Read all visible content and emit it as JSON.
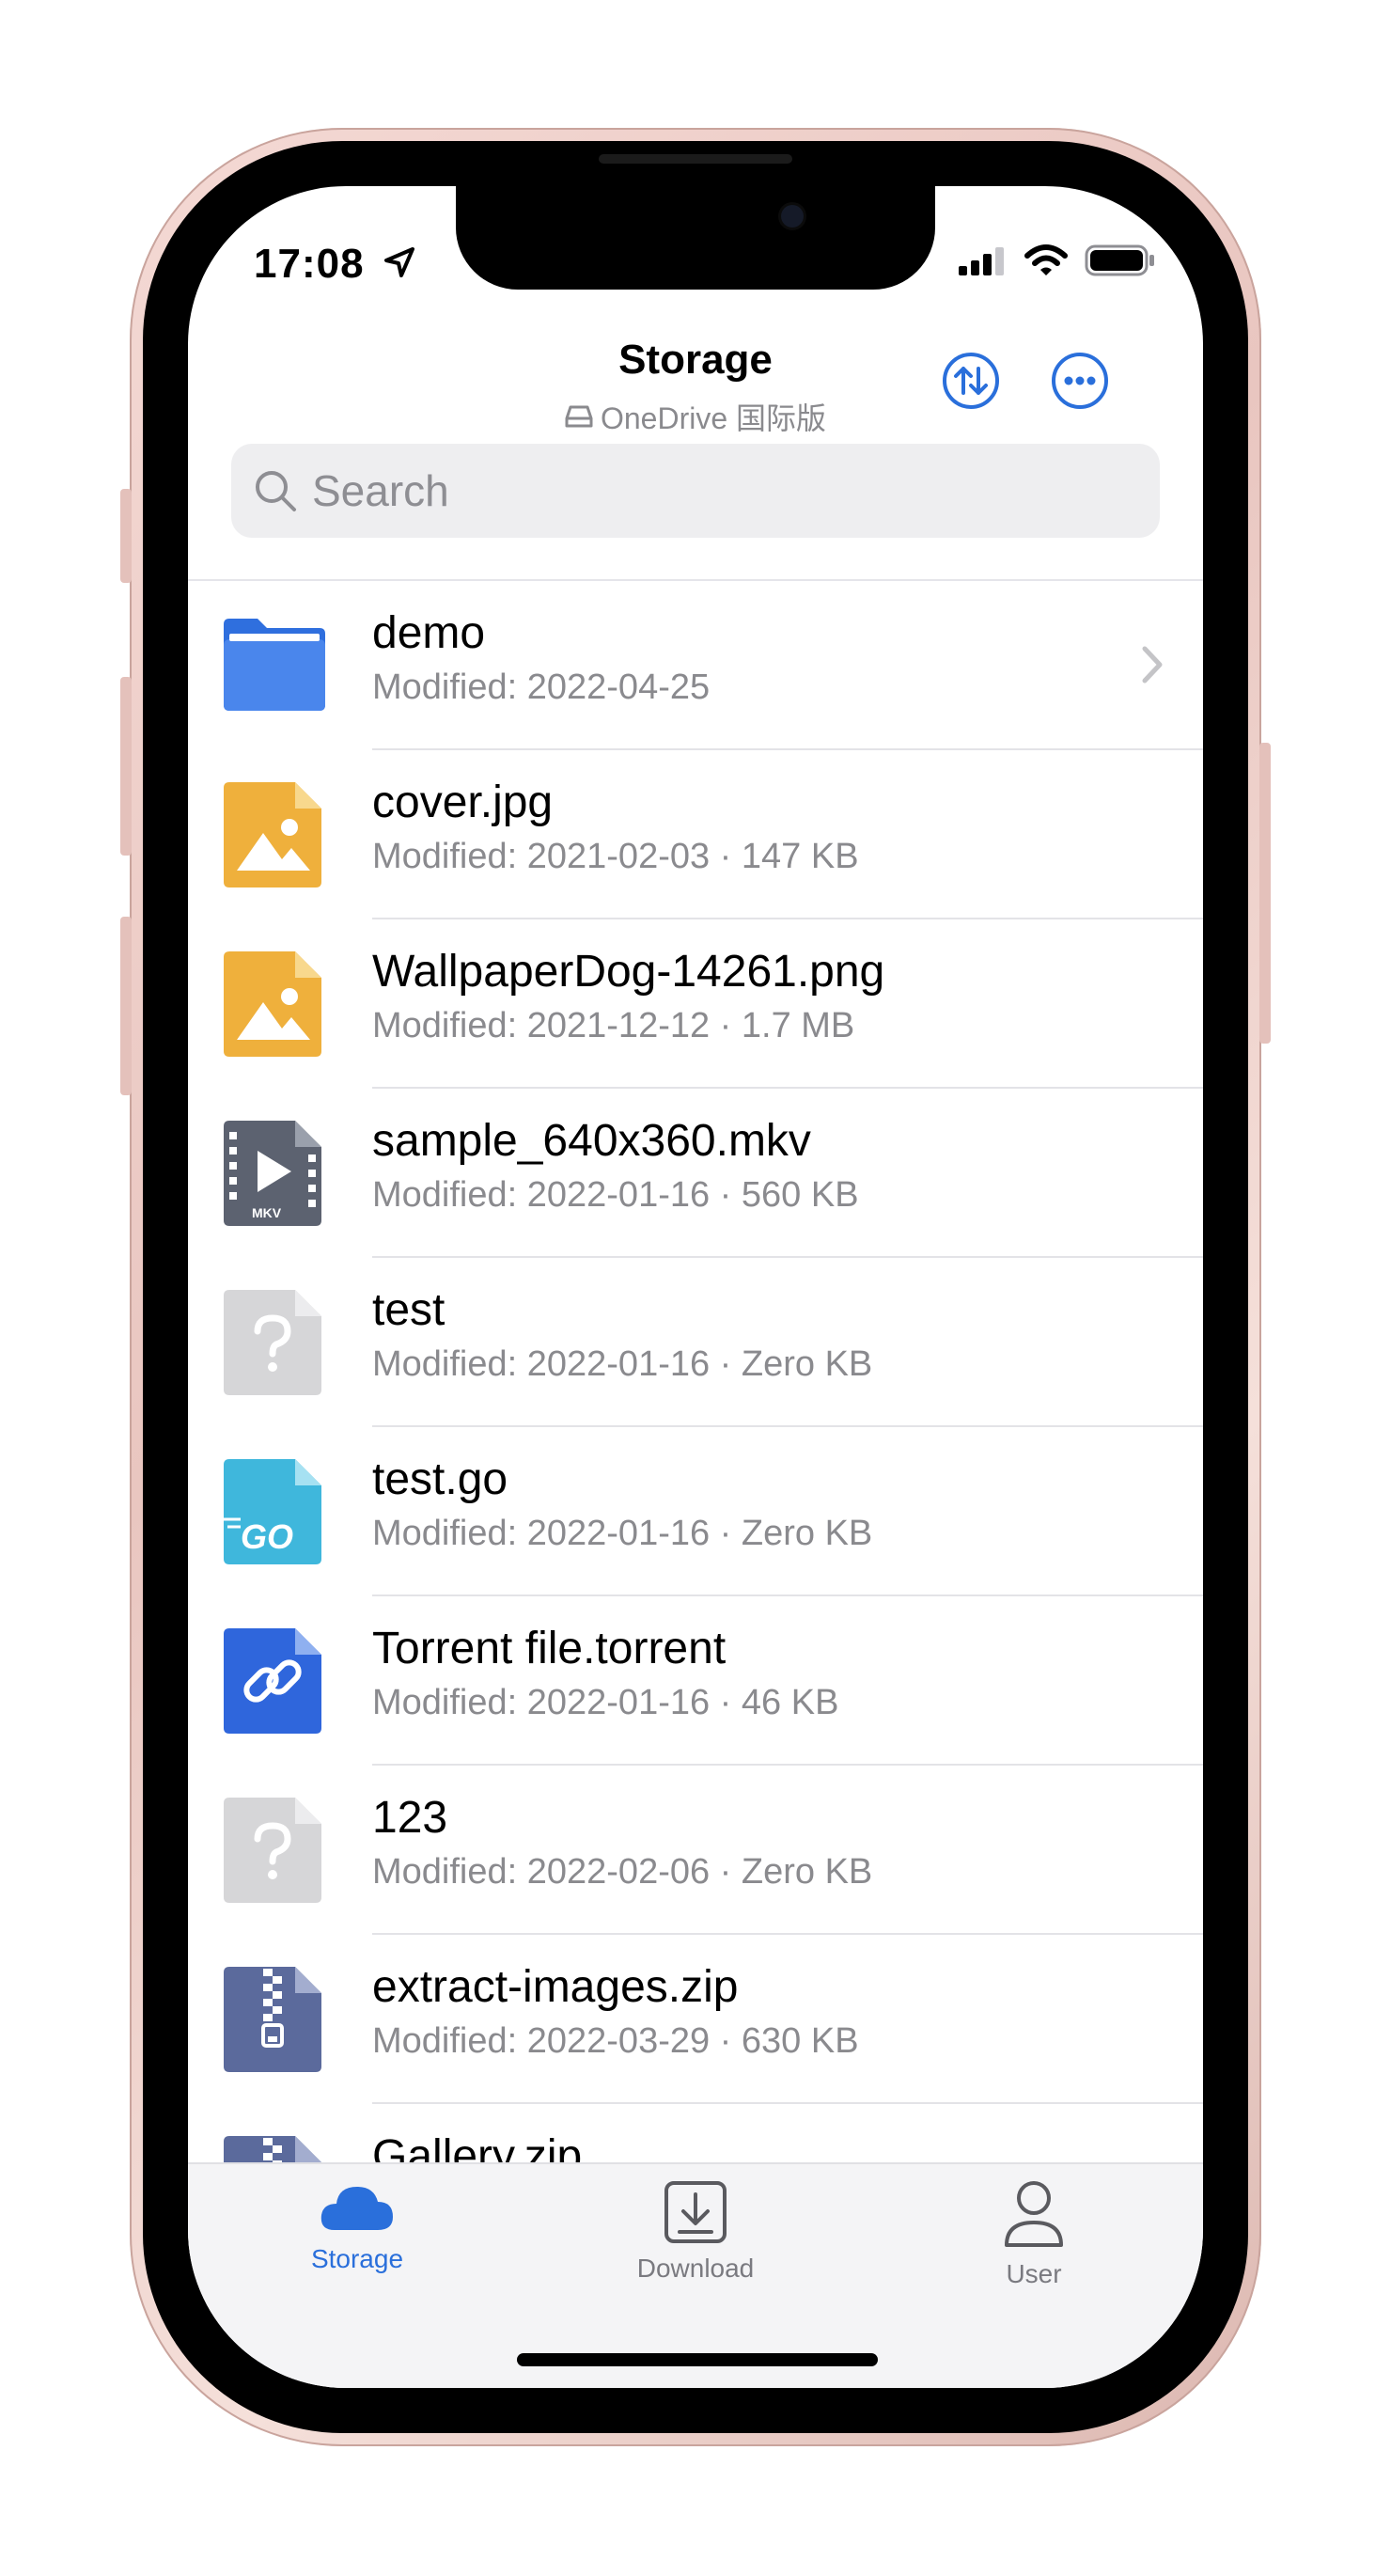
{
  "status_bar": {
    "time": "17:08"
  },
  "nav": {
    "title": "Storage",
    "subtitle": "OneDrive 国际版",
    "sort_icon": "arrow-up-down-circle-icon",
    "more_icon": "ellipsis-circle-icon"
  },
  "search": {
    "placeholder": "Search"
  },
  "files": [
    {
      "name": "demo",
      "meta": "Modified: 2022-04-25",
      "icon": "folder-icon",
      "is_folder": true
    },
    {
      "name": "cover.jpg",
      "meta": "Modified: 2021-02-03 · 147 KB",
      "icon": "image-file-icon"
    },
    {
      "name": "WallpaperDog-14261.png",
      "meta": "Modified: 2021-12-12 · 1.7 MB",
      "icon": "image-file-icon"
    },
    {
      "name": "sample_640x360.mkv",
      "meta": "Modified: 2022-01-16 · 560 KB",
      "icon": "video-file-icon",
      "icon_label": "MKV"
    },
    {
      "name": "test",
      "meta": "Modified: 2022-01-16 · Zero KB",
      "icon": "unknown-file-icon"
    },
    {
      "name": "test.go",
      "meta": "Modified: 2022-01-16 · Zero KB",
      "icon": "go-file-icon",
      "icon_label": "GO"
    },
    {
      "name": "Torrent file.torrent",
      "meta": "Modified: 2022-01-16 · 46 KB",
      "icon": "link-file-icon"
    },
    {
      "name": "123",
      "meta": "Modified: 2022-02-06 · Zero KB",
      "icon": "unknown-file-icon"
    },
    {
      "name": "extract-images.zip",
      "meta": "Modified: 2022-03-29 · 630 KB",
      "icon": "zip-file-icon"
    },
    {
      "name": "Gallery.zip",
      "meta": "",
      "icon": "zip-file-icon"
    }
  ],
  "tabs": [
    {
      "label": "Storage",
      "icon": "cloud-icon",
      "active": true
    },
    {
      "label": "Download",
      "icon": "download-tray-icon",
      "active": false
    },
    {
      "label": "User",
      "icon": "person-icon",
      "active": false
    }
  ],
  "colors": {
    "accent": "#2a6fdb",
    "folder": "#3f7ee8",
    "image": "#f0b13b",
    "video": "#5c6270",
    "unknown": "#d6d6d8",
    "go": "#3fb7dc",
    "link": "#2f66dc",
    "zip": "#5b6a9c"
  }
}
